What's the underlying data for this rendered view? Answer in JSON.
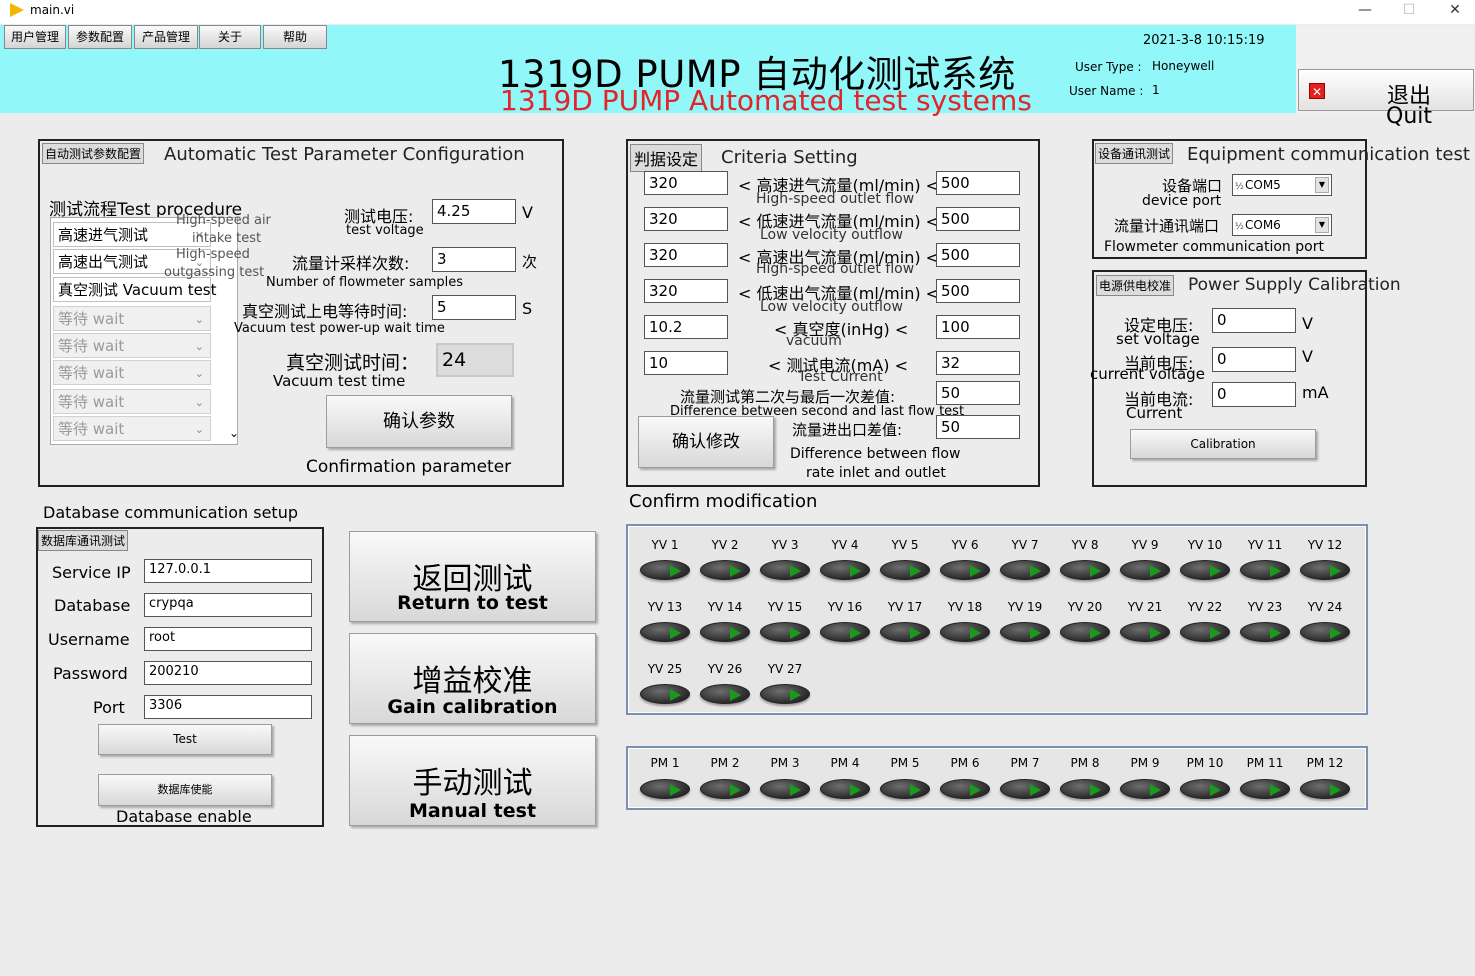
{
  "window": {
    "title": "main.vi",
    "minimize": "—",
    "maximize": "☐",
    "close": "✕"
  },
  "menu": [
    "用户管理",
    "参数配置",
    "产品管理",
    "关于",
    "帮助"
  ],
  "header": {
    "title_cn": "1319D PUMP 自动化测试系统",
    "title_en": "1319D PUMP Automated test systems",
    "datetime": "2021-3-8 10:15:19",
    "user_type_label": "User Type :",
    "user_type": "Honeywell",
    "user_name_label": "User Name :",
    "user_name": "1",
    "quit_cn": "退出",
    "quit_en": "Quit",
    "quit_icon": "close-icon"
  },
  "auto_config": {
    "tag": "自动测试参数配置",
    "title": "Automatic Test Parameter Configuration",
    "procedure_label": "测试流程Test procedure",
    "procedure_items": [
      "高速进气测试",
      "高速出气测试",
      "真空测试 Vacuum test"
    ],
    "wait_items": [
      "等待    wait",
      "等待  wait",
      "等待  wait",
      "等待  wait",
      "等待    wait"
    ],
    "overlay_1": "High-speed air",
    "overlay_2": "intake test",
    "overlay_3": "High-speed",
    "overlay_4": "outgassing test",
    "voltage_cn": "测试电压:",
    "voltage_en": "test voltage",
    "voltage_value": "4.25",
    "voltage_unit": "V",
    "samples_cn": "流量计采样次数:",
    "samples_en": "Number of flowmeter samples",
    "samples_value": "3",
    "samples_unit": "次",
    "wait_cn": "真空测试上电等待时间:",
    "wait_en": "Vacuum test power-up wait time",
    "wait_value": "5",
    "wait_unit": "S",
    "vac_time_cn": "真空测试时间：",
    "vac_time_en": "Vacuum test time",
    "vac_time_value": "24",
    "confirm_cn": "确认参数",
    "confirm_en": "Confirmation parameter"
  },
  "criteria": {
    "tag": "判据设定",
    "title": "Criteria Setting",
    "rows": [
      {
        "min": "320",
        "label": "< 高速进气流量(ml/min) <",
        "max": "500",
        "en": "High-speed outlet flow"
      },
      {
        "min": "320",
        "label": "< 低速进气流量(ml/min) <",
        "max": "500",
        "en": "Low velocity outflow"
      },
      {
        "min": "320",
        "label": "< 高速出气流量(ml/min) <",
        "max": "500",
        "en": "High-speed outlet flow"
      },
      {
        "min": "320",
        "label": "< 低速出气流量(ml/min) <",
        "max": "500",
        "en": "Low velocity outflow"
      },
      {
        "min": "10.2",
        "label": "< 真空度(inHg) <",
        "max": "100",
        "en": "vacuum"
      },
      {
        "min": "10",
        "label": "< 测试电流(mA) <",
        "max": "32",
        "en": "Test Current"
      }
    ],
    "diff_cn": "流量测试第二次与最后一次差值:",
    "diff_en": "Difference between second and last flow test",
    "diff_value": "50",
    "inout_cn": "流量进出口差值:",
    "inout_value": "50",
    "inout_en_1": "Difference between flow",
    "inout_en_2": "rate inlet and outlet",
    "confirm_cn": "确认修改",
    "confirm_en": "Confirm modification"
  },
  "equipment": {
    "tag": "设备通讯测试",
    "title": "Equipment communication test",
    "device_port_cn": "设备端口",
    "device_port_en": "device port",
    "device_port_value": "COM5",
    "flow_port_cn": "流量计通讯端口",
    "flow_port_en": "Flowmeter communication port",
    "flow_port_value": "COM6"
  },
  "power": {
    "tag": "电源供电校准",
    "title": "Power Supply Calibration",
    "set_cn": "设定电压:",
    "set_en": "set voltage",
    "set_value": "0",
    "set_unit": "V",
    "cur_v_cn": "当前电压:",
    "cur_v_en": "current voltage",
    "cur_v_value": "0",
    "cur_v_unit": "V",
    "cur_a_cn": "当前电流:",
    "cur_a_en": "Current",
    "cur_a_value": "0",
    "cur_a_unit": "mA",
    "calibrate": "Calibration"
  },
  "database": {
    "section_title": "Database communication setup",
    "tag": "数据库通讯测试",
    "fields": [
      {
        "label": "Service IP",
        "value": "127.0.0.1"
      },
      {
        "label": "Database",
        "value": "crypqa"
      },
      {
        "label": "Username",
        "value": "root"
      },
      {
        "label": "Password",
        "value": "200210"
      },
      {
        "label": "Port",
        "value": "3306"
      }
    ],
    "test_button": "Test",
    "enable_button": "数据库使能",
    "enable_en": "Database enable"
  },
  "big_buttons": [
    {
      "cn": "返回测试",
      "en": "Return to test"
    },
    {
      "cn": "增益校准",
      "en": "Gain calibration"
    },
    {
      "cn": "手动测试",
      "en": "Manual test"
    }
  ],
  "valves": [
    "YV 1",
    "YV 2",
    "YV 3",
    "YV 4",
    "YV 5",
    "YV 6",
    "YV 7",
    "YV 8",
    "YV 9",
    "YV 10",
    "YV 11",
    "YV 12",
    "YV 13",
    "YV 14",
    "YV 15",
    "YV 16",
    "YV 17",
    "YV 18",
    "YV 19",
    "YV 20",
    "YV 21",
    "YV 22",
    "YV 23",
    "YV 24",
    "YV 25",
    "YV 26",
    "YV 27"
  ],
  "pumps": [
    "PM 1",
    "PM 2",
    "PM 3",
    "PM 4",
    "PM 5",
    "PM 6",
    "PM 7",
    "PM 8",
    "PM 9",
    "PM 10",
    "PM 11",
    "PM 12"
  ]
}
